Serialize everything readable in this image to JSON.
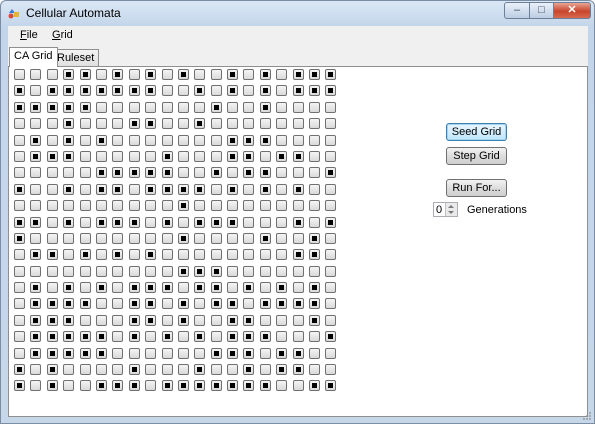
{
  "window": {
    "title": "Cellular Automata",
    "minimize_glyph": "‒",
    "maximize_glyph": "□",
    "close_glyph": "✕"
  },
  "menu": {
    "items": [
      {
        "label": "File",
        "underline": "F"
      },
      {
        "label": "Grid",
        "underline": "G"
      }
    ]
  },
  "tabs": [
    {
      "label": "CA Grid",
      "active": true
    },
    {
      "label": "Ruleset",
      "active": false
    }
  ],
  "controls": {
    "seed_label": "Seed Grid",
    "step_label": "Step Grid",
    "run_label": "Run For...",
    "generations_value": "0",
    "generations_label": "Generations"
  },
  "grid": {
    "rows": 20,
    "cols": 20,
    "cells": [
      "00011010101001010111",
      "10111111100101010111",
      "11111000000010010000",
      "00010001100100000000",
      "01010100000001110000",
      "01110000010001101100",
      "00000111110010110001",
      "10010110111101010100",
      "00000000001000000000",
      "11010111010111000101",
      "10000000001000010010",
      "01101010100000000110",
      "00000000001110000000",
      "01010101110110101010",
      "01111001101011011110",
      "01110001101001100010",
      "01111101010101110001",
      "01111100000011101100",
      "10100001000100101100",
      "10100111011111110011"
    ]
  }
}
